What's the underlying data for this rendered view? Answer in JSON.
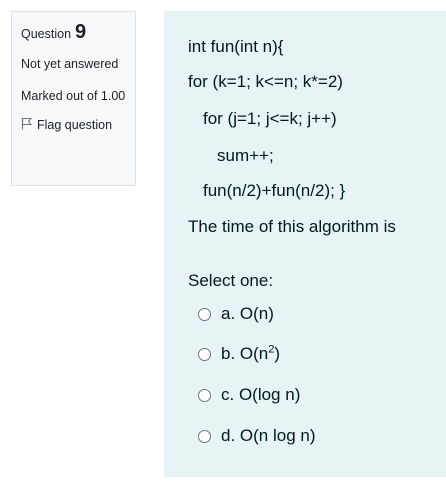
{
  "info": {
    "question_label": "Question",
    "question_number": "9",
    "state": "Not yet answered",
    "grade": "Marked out of 1.00",
    "flag_label": "Flag question"
  },
  "question": {
    "code_lines": [
      "int fun(int n){",
      "for (k=1; k<=n; k*=2)",
      "for (j=1; j<=k; j++)",
      "sum++;",
      "fun(n/2)+fun(n/2); }"
    ],
    "prompt": "The time of this algorithm is",
    "select_one": "Select one:"
  },
  "options": [
    {
      "prefix": "a. O(n",
      "sup": "",
      "suffix": ")"
    },
    {
      "prefix": "b. O(n",
      "sup": "2",
      "suffix": ")"
    },
    {
      "prefix": "c. O(log n)",
      "sup": "",
      "suffix": ""
    },
    {
      "prefix": "d. O(n log n)",
      "sup": "",
      "suffix": ""
    }
  ],
  "colors": {
    "info_bg": "#f8f9fa",
    "content_bg": "#e7f3f5",
    "text": "#001a1e"
  }
}
